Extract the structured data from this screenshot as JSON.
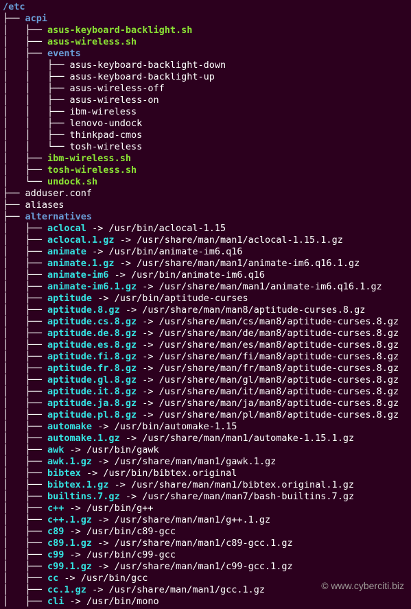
{
  "tree": [
    {
      "prefix": "",
      "cls": "dir",
      "name": "/etc"
    },
    {
      "prefix": "├── ",
      "cls": "dir",
      "name": "acpi"
    },
    {
      "prefix": "│   ├── ",
      "cls": "exec",
      "name": "asus-keyboard-backlight.sh"
    },
    {
      "prefix": "│   ├── ",
      "cls": "exec",
      "name": "asus-wireless.sh"
    },
    {
      "prefix": "│   ├── ",
      "cls": "dir",
      "name": "events"
    },
    {
      "prefix": "│   │   ├── ",
      "cls": "file",
      "name": "asus-keyboard-backlight-down"
    },
    {
      "prefix": "│   │   ├── ",
      "cls": "file",
      "name": "asus-keyboard-backlight-up"
    },
    {
      "prefix": "│   │   ├── ",
      "cls": "file",
      "name": "asus-wireless-off"
    },
    {
      "prefix": "│   │   ├── ",
      "cls": "file",
      "name": "asus-wireless-on"
    },
    {
      "prefix": "│   │   ├── ",
      "cls": "file",
      "name": "ibm-wireless"
    },
    {
      "prefix": "│   │   ├── ",
      "cls": "file",
      "name": "lenovo-undock"
    },
    {
      "prefix": "│   │   ├── ",
      "cls": "file",
      "name": "thinkpad-cmos"
    },
    {
      "prefix": "│   │   └── ",
      "cls": "file",
      "name": "tosh-wireless"
    },
    {
      "prefix": "│   ├── ",
      "cls": "exec",
      "name": "ibm-wireless.sh"
    },
    {
      "prefix": "│   ├── ",
      "cls": "exec",
      "name": "tosh-wireless.sh"
    },
    {
      "prefix": "│   └── ",
      "cls": "exec",
      "name": "undock.sh"
    },
    {
      "prefix": "├── ",
      "cls": "file",
      "name": "adduser.conf"
    },
    {
      "prefix": "├── ",
      "cls": "file",
      "name": "aliases"
    },
    {
      "prefix": "├── ",
      "cls": "dir",
      "name": "alternatives"
    },
    {
      "prefix": "│   ├── ",
      "cls": "sym",
      "name": "aclocal",
      "target": "/usr/bin/aclocal-1.15"
    },
    {
      "prefix": "│   ├── ",
      "cls": "sym",
      "name": "aclocal.1.gz",
      "target": "/usr/share/man/man1/aclocal-1.15.1.gz"
    },
    {
      "prefix": "│   ├── ",
      "cls": "sym",
      "name": "animate",
      "target": "/usr/bin/animate-im6.q16"
    },
    {
      "prefix": "│   ├── ",
      "cls": "sym",
      "name": "animate.1.gz",
      "target": "/usr/share/man/man1/animate-im6.q16.1.gz"
    },
    {
      "prefix": "│   ├── ",
      "cls": "sym",
      "name": "animate-im6",
      "target": "/usr/bin/animate-im6.q16"
    },
    {
      "prefix": "│   ├── ",
      "cls": "sym",
      "name": "animate-im6.1.gz",
      "target": "/usr/share/man/man1/animate-im6.q16.1.gz"
    },
    {
      "prefix": "│   ├── ",
      "cls": "sym",
      "name": "aptitude",
      "target": "/usr/bin/aptitude-curses"
    },
    {
      "prefix": "│   ├── ",
      "cls": "sym",
      "name": "aptitude.8.gz",
      "target": "/usr/share/man/man8/aptitude-curses.8.gz"
    },
    {
      "prefix": "│   ├── ",
      "cls": "sym",
      "name": "aptitude.cs.8.gz",
      "target": "/usr/share/man/cs/man8/aptitude-curses.8.gz"
    },
    {
      "prefix": "│   ├── ",
      "cls": "sym",
      "name": "aptitude.de.8.gz",
      "target": "/usr/share/man/de/man8/aptitude-curses.8.gz"
    },
    {
      "prefix": "│   ├── ",
      "cls": "sym",
      "name": "aptitude.es.8.gz",
      "target": "/usr/share/man/es/man8/aptitude-curses.8.gz"
    },
    {
      "prefix": "│   ├── ",
      "cls": "sym",
      "name": "aptitude.fi.8.gz",
      "target": "/usr/share/man/fi/man8/aptitude-curses.8.gz"
    },
    {
      "prefix": "│   ├── ",
      "cls": "sym",
      "name": "aptitude.fr.8.gz",
      "target": "/usr/share/man/fr/man8/aptitude-curses.8.gz"
    },
    {
      "prefix": "│   ├── ",
      "cls": "sym",
      "name": "aptitude.gl.8.gz",
      "target": "/usr/share/man/gl/man8/aptitude-curses.8.gz"
    },
    {
      "prefix": "│   ├── ",
      "cls": "sym",
      "name": "aptitude.it.8.gz",
      "target": "/usr/share/man/it/man8/aptitude-curses.8.gz"
    },
    {
      "prefix": "│   ├── ",
      "cls": "sym",
      "name": "aptitude.ja.8.gz",
      "target": "/usr/share/man/ja/man8/aptitude-curses.8.gz"
    },
    {
      "prefix": "│   ├── ",
      "cls": "sym",
      "name": "aptitude.pl.8.gz",
      "target": "/usr/share/man/pl/man8/aptitude-curses.8.gz"
    },
    {
      "prefix": "│   ├── ",
      "cls": "sym",
      "name": "automake",
      "target": "/usr/bin/automake-1.15"
    },
    {
      "prefix": "│   ├── ",
      "cls": "sym",
      "name": "automake.1.gz",
      "target": "/usr/share/man/man1/automake-1.15.1.gz"
    },
    {
      "prefix": "│   ├── ",
      "cls": "sym",
      "name": "awk",
      "target": "/usr/bin/gawk"
    },
    {
      "prefix": "│   ├── ",
      "cls": "sym",
      "name": "awk.1.gz",
      "target": "/usr/share/man/man1/gawk.1.gz"
    },
    {
      "prefix": "│   ├── ",
      "cls": "sym",
      "name": "bibtex",
      "target": "/usr/bin/bibtex.original"
    },
    {
      "prefix": "│   ├── ",
      "cls": "sym",
      "name": "bibtex.1.gz",
      "target": "/usr/share/man/man1/bibtex.original.1.gz"
    },
    {
      "prefix": "│   ├── ",
      "cls": "sym",
      "name": "builtins.7.gz",
      "target": "/usr/share/man/man7/bash-builtins.7.gz"
    },
    {
      "prefix": "│   ├── ",
      "cls": "sym",
      "name": "c++",
      "target": "/usr/bin/g++"
    },
    {
      "prefix": "│   ├── ",
      "cls": "sym",
      "name": "c++.1.gz",
      "target": "/usr/share/man/man1/g++.1.gz"
    },
    {
      "prefix": "│   ├── ",
      "cls": "sym",
      "name": "c89",
      "target": "/usr/bin/c89-gcc"
    },
    {
      "prefix": "│   ├── ",
      "cls": "sym",
      "name": "c89.1.gz",
      "target": "/usr/share/man/man1/c89-gcc.1.gz"
    },
    {
      "prefix": "│   ├── ",
      "cls": "sym",
      "name": "c99",
      "target": "/usr/bin/c99-gcc"
    },
    {
      "prefix": "│   ├── ",
      "cls": "sym",
      "name": "c99.1.gz",
      "target": "/usr/share/man/man1/c99-gcc.1.gz"
    },
    {
      "prefix": "│   ├── ",
      "cls": "sym",
      "name": "cc",
      "target": "/usr/bin/gcc"
    },
    {
      "prefix": "│   ├── ",
      "cls": "sym",
      "name": "cc.1.gz",
      "target": "/usr/share/man/man1/gcc.1.gz"
    },
    {
      "prefix": "│   ├── ",
      "cls": "sym",
      "name": "cli",
      "target": "/usr/bin/mono"
    }
  ],
  "watermark": "©  www.cyberciti.biz"
}
